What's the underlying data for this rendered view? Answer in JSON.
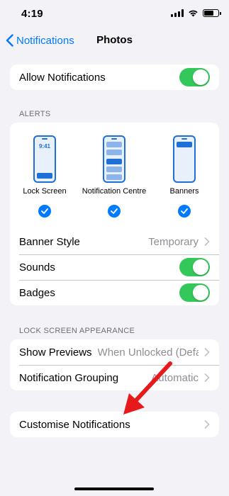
{
  "status_bar": {
    "time": "4:19"
  },
  "nav": {
    "back_label": "Notifications",
    "title": "Photos"
  },
  "allow_notifications": {
    "label": "Allow Notifications",
    "enabled": true
  },
  "alerts": {
    "header": "ALERTS",
    "styles": [
      {
        "label": "Lock Screen",
        "preview_time": "9:41",
        "selected": true
      },
      {
        "label": "Notification Centre",
        "selected": true
      },
      {
        "label": "Banners",
        "selected": true
      }
    ],
    "banner_style": {
      "label": "Banner Style",
      "value": "Temporary"
    },
    "sounds": {
      "label": "Sounds",
      "enabled": true
    },
    "badges": {
      "label": "Badges",
      "enabled": true
    }
  },
  "lock_screen_appearance": {
    "header": "LOCK SCREEN APPEARANCE",
    "show_previews": {
      "label": "Show Previews",
      "value": "When Unlocked (Defa..."
    },
    "notification_grouping": {
      "label": "Notification Grouping",
      "value": "Automatic"
    }
  },
  "customise": {
    "label": "Customise Notifications"
  },
  "colors": {
    "accent": "#007aff",
    "toggle_on": "#34c759",
    "annotation_arrow": "#e8191a",
    "background": "#f2f2f7"
  }
}
